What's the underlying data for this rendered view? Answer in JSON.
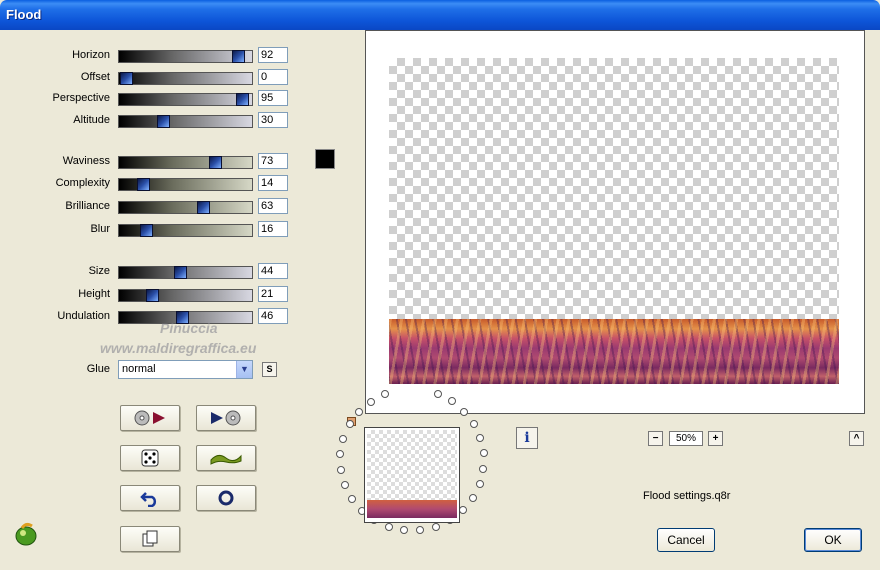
{
  "window": {
    "title": "Flood"
  },
  "sliders": [
    {
      "label": "Horizon",
      "value": "92",
      "fraction": 0.92,
      "gradient": "g1"
    },
    {
      "label": "Offset",
      "value": "0",
      "fraction": 0.0,
      "gradient": "g1"
    },
    {
      "label": "Perspective",
      "value": "95",
      "fraction": 0.95,
      "gradient": "g1"
    },
    {
      "label": "Altitude",
      "value": "30",
      "fraction": 0.3,
      "gradient": "g1"
    },
    {
      "label": "Waviness",
      "value": "73",
      "fraction": 0.73,
      "gradient": "g2"
    },
    {
      "label": "Complexity",
      "value": "14",
      "fraction": 0.14,
      "gradient": "g2"
    },
    {
      "label": "Brilliance",
      "value": "63",
      "fraction": 0.63,
      "gradient": "g2"
    },
    {
      "label": "Blur",
      "value": "16",
      "fraction": 0.16,
      "gradient": "g2"
    },
    {
      "label": "Size",
      "value": "44",
      "fraction": 0.44,
      "gradient": "g1"
    },
    {
      "label": "Height",
      "value": "21",
      "fraction": 0.21,
      "gradient": "g1"
    },
    {
      "label": "Undulation",
      "value": "46",
      "fraction": 0.46,
      "gradient": "g1"
    }
  ],
  "glue": {
    "label": "Glue",
    "value": "normal",
    "s_label": "S"
  },
  "color_swatch": "#000000",
  "watermark": {
    "line1": "Pinuccia",
    "line2": "www.maldiregraffica.eu"
  },
  "zoom": {
    "value": "50%",
    "minus": "−",
    "plus": "+"
  },
  "settings_file": "Flood settings.q8r",
  "buttons": {
    "cancel": "Cancel",
    "ok": "OK",
    "info": "i",
    "collapse": "^"
  },
  "icons": [
    "load-preset-icon",
    "save-preset-icon",
    "random-dice-icon",
    "wave-icon",
    "undo-icon",
    "reset-circle-icon",
    "copy-icon",
    "app-logo-icon"
  ]
}
